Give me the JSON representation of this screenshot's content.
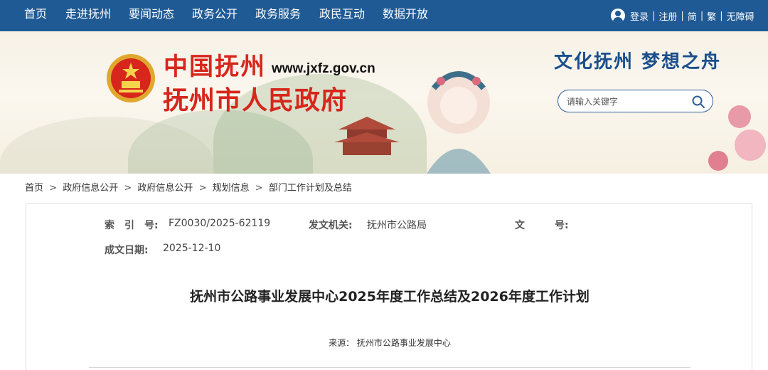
{
  "nav": {
    "items": [
      "首页",
      "走进抚州",
      "要闻动态",
      "政务公开",
      "政务服务",
      "政民互动",
      "数据开放"
    ]
  },
  "user": {
    "login": "登录",
    "register": "注册",
    "simplified": "简",
    "traditional": "繁",
    "accessibility": "无障碍",
    "separator": "|"
  },
  "banner": {
    "calligraphy": "中国抚州",
    "url": "www.jxfz.gov.cn",
    "site_name": "抚州市人民政府",
    "slogan": "文化抚州 梦想之舟",
    "search_placeholder": "请输入关键字"
  },
  "breadcrumb": {
    "items": [
      "首页",
      "政府信息公开",
      "政府信息公开",
      "规划信息",
      "部门工作计划及总结"
    ],
    "separator": ">"
  },
  "meta": {
    "index_label": "索　引　号:",
    "index_value": "FZ0030/2025-62119",
    "issuer_label": "发文机关:",
    "issuer_value": "抚州市公路局",
    "docno_label": "文　　　号:",
    "date_label": "成文日期:",
    "date_value": "2025-12-10"
  },
  "article": {
    "title": "抚州市公路事业发展中心2025年度工作总结及2026年度工作计划",
    "source_label": "来源：",
    "source_value": "抚州市公路事业发展中心"
  },
  "colors": {
    "nav_bg": "#1f5a94",
    "logo_red": "#d7261b",
    "slogan_blue": "#1a4f8c"
  },
  "icons": {
    "user": "user-icon",
    "search": "search-icon",
    "emblem": "national-emblem-icon"
  }
}
